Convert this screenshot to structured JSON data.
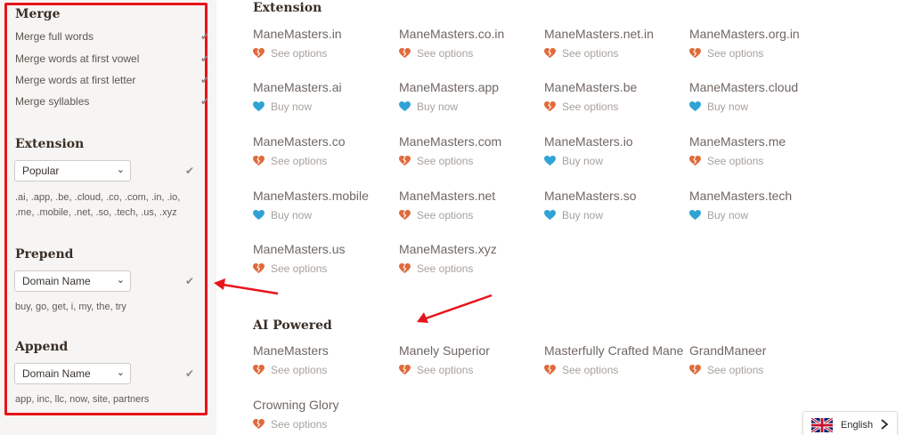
{
  "sidebar": {
    "merge": {
      "title": "Merge",
      "options": [
        "Merge full words",
        "Merge words at first vowel",
        "Merge words at first letter",
        "Merge syllables"
      ]
    },
    "extension": {
      "title": "Extension",
      "selected": "Popular",
      "helper": ".ai, .app, .be, .cloud, .co, .com, .in, .io, .me, .mobile, .net, .so, .tech, .us, .xyz"
    },
    "prepend": {
      "title": "Prepend",
      "selected": "Domain Name",
      "helper": "buy, go, get, i, my, the, try"
    },
    "append": {
      "title": "Append",
      "selected": "Domain Name",
      "helper": "app, inc, llc, now, site, partners"
    }
  },
  "main": {
    "extension_section": {
      "title": "Extension",
      "domains": [
        {
          "name": "ManeMasters.in",
          "action": "See options",
          "icon": "broken-heart-icon"
        },
        {
          "name": "ManeMasters.co.in",
          "action": "See options",
          "icon": "broken-heart-icon"
        },
        {
          "name": "ManeMasters.net.in",
          "action": "See options",
          "icon": "broken-heart-icon"
        },
        {
          "name": "ManeMasters.org.in",
          "action": "See options",
          "icon": "broken-heart-icon"
        },
        {
          "name": "ManeMasters.ai",
          "action": "Buy now",
          "icon": "heart-icon"
        },
        {
          "name": "ManeMasters.app",
          "action": "Buy now",
          "icon": "heart-icon"
        },
        {
          "name": "ManeMasters.be",
          "action": "See options",
          "icon": "broken-heart-icon"
        },
        {
          "name": "ManeMasters.cloud",
          "action": "Buy now",
          "icon": "heart-icon"
        },
        {
          "name": "ManeMasters.co",
          "action": "See options",
          "icon": "broken-heart-icon"
        },
        {
          "name": "ManeMasters.com",
          "action": "See options",
          "icon": "broken-heart-icon"
        },
        {
          "name": "ManeMasters.io",
          "action": "Buy now",
          "icon": "heart-icon"
        },
        {
          "name": "ManeMasters.me",
          "action": "See options",
          "icon": "broken-heart-icon"
        },
        {
          "name": "ManeMasters.mobile",
          "action": "Buy now",
          "icon": "heart-icon"
        },
        {
          "name": "ManeMasters.net",
          "action": "See options",
          "icon": "broken-heart-icon"
        },
        {
          "name": "ManeMasters.so",
          "action": "Buy now",
          "icon": "heart-icon"
        },
        {
          "name": "ManeMasters.tech",
          "action": "Buy now",
          "icon": "heart-icon"
        },
        {
          "name": "ManeMasters.us",
          "action": "See options",
          "icon": "broken-heart-icon"
        },
        {
          "name": "ManeMasters.xyz",
          "action": "See options",
          "icon": "broken-heart-icon"
        }
      ]
    },
    "ai_section": {
      "title": "AI Powered",
      "domains": [
        {
          "name": "ManeMasters",
          "action": "See options",
          "icon": "broken-heart-icon"
        },
        {
          "name": "Manely Superior",
          "action": "See options",
          "icon": "broken-heart-icon"
        },
        {
          "name": "Masterfully Crafted Mane",
          "action": "See options",
          "icon": "broken-heart-icon"
        },
        {
          "name": "GrandManeer",
          "action": "See options",
          "icon": "broken-heart-icon"
        },
        {
          "name": "Crowning Glory",
          "action": "See options",
          "icon": "broken-heart-icon"
        }
      ]
    }
  },
  "language": {
    "label": "English",
    "flag": "uk-flag-icon"
  },
  "colors": {
    "annotation": "#e8141b",
    "broken_heart": "#e06a3b",
    "heart": "#2fa3d6",
    "sidebar_bg": "#f6f5f3"
  }
}
